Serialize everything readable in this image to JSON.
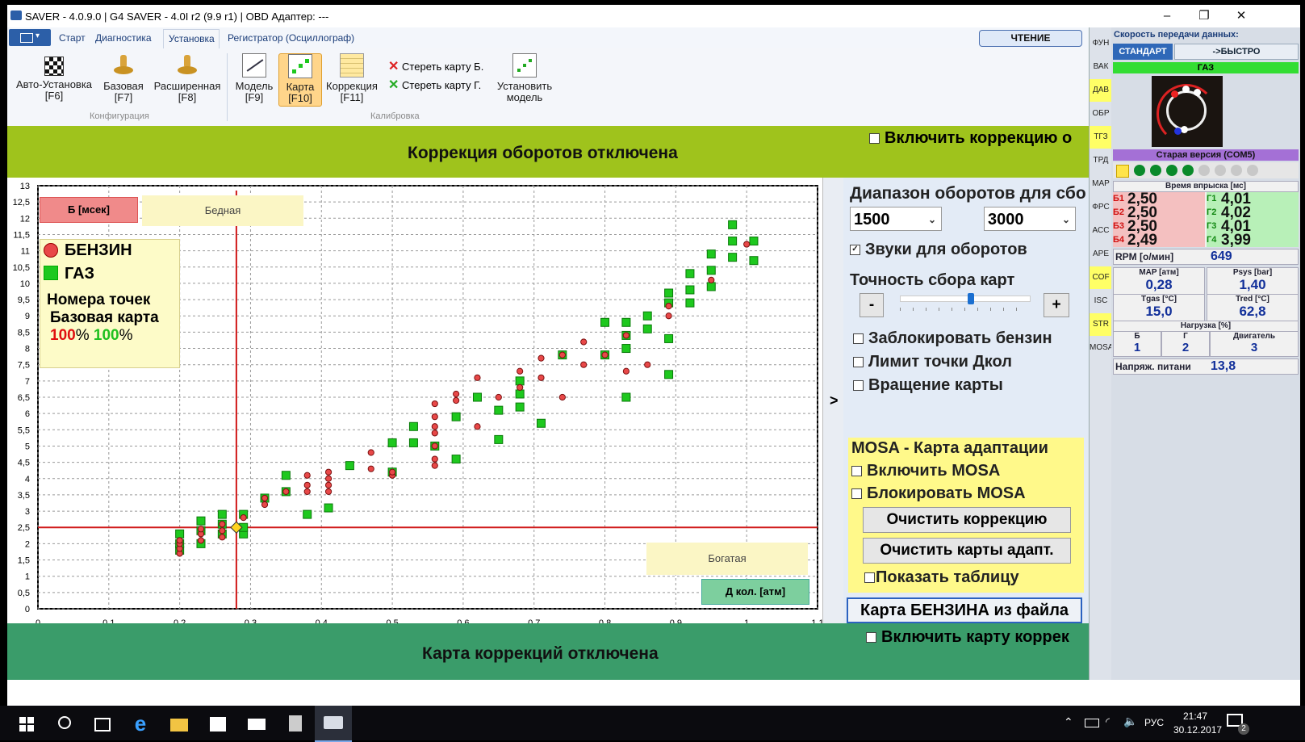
{
  "window": {
    "title": "SAVER - 4.0.9.0  |  G4 SAVER - 4.0I r2 (9.9 r1)  |  OBD Адаптер: ---",
    "controls": [
      "–",
      "❐",
      "✕"
    ]
  },
  "ribbon": {
    "tabs": [
      "Старт",
      "Диагностика",
      "Установка",
      "Регистратор (Осциллограф)"
    ],
    "active_tab": "Установка",
    "read_button": "ЧТЕНИЕ",
    "buttons": [
      {
        "label": "Авто-Установка",
        "key": "[F6]"
      },
      {
        "label": "Базовая",
        "key": "[F7]"
      },
      {
        "label": "Расширенная",
        "key": "[F8]"
      },
      {
        "label": "Модель",
        "key": "[F9]"
      },
      {
        "label": "Карта",
        "key": "[F10]"
      },
      {
        "label": "Коррекция",
        "key": "[F11]"
      }
    ],
    "erase_b": "Стереть карту Б.",
    "erase_g": "Стереть карту Г.",
    "install_model": "Установить модель",
    "group_config": "Конфигурация",
    "group_calib": "Калибровка"
  },
  "top_banner": {
    "text": "Коррекция оборотов отключена",
    "checkbox": "Включить коррекцию о"
  },
  "bottom_banner": {
    "text": "Карта коррекций отключена",
    "checkbox": "Включить карту коррек"
  },
  "chart_overlay": {
    "b_label": "Б [мсек]",
    "lean": "Бедная",
    "rich": "Богатая",
    "d_label": "Д кол. [атм]",
    "legend_petrol": "БЕНЗИН",
    "legend_gas": "ГАЗ",
    "points_title": "Номера точек",
    "base_map": "Базовая карта",
    "pct_red": "100",
    "pct_green": "100",
    "pct_sign": "%",
    "arrow": ">"
  },
  "chart_data": {
    "type": "scatter",
    "xlim": [
      0,
      1.1
    ],
    "ylim": [
      0,
      13
    ],
    "x_ticks": [
      "0",
      "0,1",
      "0,2",
      "0,3",
      "0,4",
      "0,5",
      "0,6",
      "0,7",
      "0,8",
      "0,9",
      "1",
      "1,1"
    ],
    "y_ticks": [
      "0",
      "0,5",
      "1",
      "1,5",
      "2",
      "2,5",
      "3",
      "3,5",
      "4",
      "4,5",
      "5",
      "5,5",
      "6",
      "6,5",
      "7",
      "7,5",
      "8",
      "8,5",
      "9",
      "9,5",
      "10",
      "10,5",
      "11",
      "11,5",
      "12",
      "12,5",
      "13"
    ],
    "grid": true,
    "cursor": {
      "x": 0.28,
      "y": 2.5
    },
    "series": [
      {
        "name": "БЕНЗИН",
        "color": "#e84848",
        "marker": "circle",
        "points": [
          [
            0.2,
            1.7
          ],
          [
            0.2,
            1.85
          ],
          [
            0.2,
            2.0
          ],
          [
            0.2,
            2.1
          ],
          [
            0.23,
            2.1
          ],
          [
            0.23,
            2.3
          ],
          [
            0.23,
            2.45
          ],
          [
            0.26,
            2.2
          ],
          [
            0.26,
            2.4
          ],
          [
            0.26,
            2.6
          ],
          [
            0.29,
            2.8
          ],
          [
            0.32,
            3.2
          ],
          [
            0.32,
            3.4
          ],
          [
            0.35,
            3.6
          ],
          [
            0.38,
            3.6
          ],
          [
            0.38,
            3.8
          ],
          [
            0.38,
            4.1
          ],
          [
            0.41,
            3.6
          ],
          [
            0.41,
            3.8
          ],
          [
            0.41,
            4.0
          ],
          [
            0.41,
            4.2
          ],
          [
            0.47,
            4.3
          ],
          [
            0.47,
            4.8
          ],
          [
            0.5,
            4.1
          ],
          [
            0.5,
            4.2
          ],
          [
            0.56,
            4.4
          ],
          [
            0.56,
            4.6
          ],
          [
            0.56,
            5.0
          ],
          [
            0.56,
            5.4
          ],
          [
            0.56,
            5.6
          ],
          [
            0.56,
            5.9
          ],
          [
            0.56,
            6.3
          ],
          [
            0.59,
            6.4
          ],
          [
            0.59,
            6.6
          ],
          [
            0.62,
            5.6
          ],
          [
            0.62,
            7.1
          ],
          [
            0.65,
            6.5
          ],
          [
            0.68,
            6.8
          ],
          [
            0.68,
            7.3
          ],
          [
            0.71,
            7.1
          ],
          [
            0.71,
            7.7
          ],
          [
            0.74,
            7.8
          ],
          [
            0.74,
            6.5
          ],
          [
            0.77,
            7.5
          ],
          [
            0.77,
            8.2
          ],
          [
            0.8,
            7.8
          ],
          [
            0.83,
            7.3
          ],
          [
            0.83,
            8.4
          ],
          [
            0.86,
            7.5
          ],
          [
            0.89,
            9.3
          ],
          [
            0.89,
            9.0
          ],
          [
            0.95,
            10.1
          ],
          [
            1.0,
            11.2
          ]
        ]
      },
      {
        "name": "ГАЗ",
        "color": "#1ec81e",
        "marker": "square",
        "points": [
          [
            0.2,
            1.8
          ],
          [
            0.2,
            2.0
          ],
          [
            0.2,
            2.3
          ],
          [
            0.23,
            2.0
          ],
          [
            0.23,
            2.4
          ],
          [
            0.23,
            2.7
          ],
          [
            0.26,
            2.3
          ],
          [
            0.26,
            2.6
          ],
          [
            0.26,
            2.9
          ],
          [
            0.29,
            2.3
          ],
          [
            0.29,
            2.5
          ],
          [
            0.29,
            2.9
          ],
          [
            0.32,
            3.4
          ],
          [
            0.35,
            3.6
          ],
          [
            0.35,
            4.1
          ],
          [
            0.38,
            2.9
          ],
          [
            0.41,
            3.1
          ],
          [
            0.44,
            4.4
          ],
          [
            0.5,
            4.2
          ],
          [
            0.5,
            5.1
          ],
          [
            0.53,
            5.1
          ],
          [
            0.53,
            5.6
          ],
          [
            0.56,
            5.0
          ],
          [
            0.59,
            4.6
          ],
          [
            0.59,
            5.9
          ],
          [
            0.62,
            6.5
          ],
          [
            0.65,
            5.2
          ],
          [
            0.65,
            6.1
          ],
          [
            0.68,
            6.2
          ],
          [
            0.68,
            6.6
          ],
          [
            0.68,
            7.0
          ],
          [
            0.71,
            5.7
          ],
          [
            0.74,
            7.8
          ],
          [
            0.8,
            7.8
          ],
          [
            0.8,
            8.8
          ],
          [
            0.83,
            6.5
          ],
          [
            0.83,
            8.0
          ],
          [
            0.83,
            8.4
          ],
          [
            0.83,
            8.8
          ],
          [
            0.86,
            8.6
          ],
          [
            0.86,
            9.0
          ],
          [
            0.89,
            7.2
          ],
          [
            0.89,
            8.3
          ],
          [
            0.89,
            9.4
          ],
          [
            0.89,
            9.7
          ],
          [
            0.92,
            9.4
          ],
          [
            0.92,
            9.8
          ],
          [
            0.92,
            10.3
          ],
          [
            0.95,
            9.9
          ],
          [
            0.95,
            10.4
          ],
          [
            0.95,
            10.9
          ],
          [
            0.98,
            10.8
          ],
          [
            0.98,
            11.3
          ],
          [
            0.98,
            11.8
          ],
          [
            1.01,
            10.7
          ],
          [
            1.01,
            11.3
          ]
        ]
      }
    ]
  },
  "settings": {
    "rpm_range_label": "Диапазон оборотов для сбо",
    "rpm_min": "1500",
    "rpm_max": "3000",
    "sounds": "Звуки для оборотов",
    "precision": "Точность сбора карт",
    "minus": "-",
    "plus": "+",
    "slider_level": 0.55,
    "lock_petrol": "Заблокировать бензин",
    "limit_point": "Лимит точки Дкол",
    "rotate_map": "Вращение карты",
    "mosa_title": "MOSA - Карта адаптации",
    "enable_mosa": "Включить MOSA",
    "block_mosa": "Блокировать MOSA",
    "clear_correction": "Очистить коррекцию",
    "clear_maps": "Очистить карты адапт.",
    "show_table": "Показать таблицу",
    "petrol_from_file": "Карта БЕНЗИНА из файла"
  },
  "side_strip": [
    {
      "label": "ФУН",
      "highlight": false
    },
    {
      "label": "ВАК",
      "highlight": false
    },
    {
      "label": "ДАВ",
      "highlight": true
    },
    {
      "label": "ОБР",
      "highlight": false
    },
    {
      "label": "ТГЗ",
      "highlight": true
    },
    {
      "label": "ТРД",
      "highlight": false
    },
    {
      "label": "МАР",
      "highlight": false
    },
    {
      "label": "ФРС",
      "highlight": false
    },
    {
      "label": "АСС",
      "highlight": false
    },
    {
      "label": "АРЕ",
      "highlight": false
    },
    {
      "label": "COF",
      "highlight": true
    },
    {
      "label": "ISC",
      "highlight": false
    },
    {
      "label": "STR",
      "highlight": true
    },
    {
      "label": "MOSA",
      "highlight": false
    }
  ],
  "status": {
    "speed_title": "Скорость передачи данных:",
    "std": "СТАНДАРТ",
    "fast": "->БЫСТРО",
    "gas": "ГАЗ",
    "old_version": "Старая версия (COM5)",
    "inj_title": "Время впрыска [мс]",
    "injectors": [
      {
        "b": "Б1",
        "bv": "2,50",
        "g": "Г1",
        "gv": "4,01"
      },
      {
        "b": "Б2",
        "bv": "2,50",
        "g": "Г2",
        "gv": "4,02"
      },
      {
        "b": "Б3",
        "bv": "2,50",
        "g": "Г3",
        "gv": "4,01"
      },
      {
        "b": "Б4",
        "bv": "2,49",
        "g": "Г4",
        "gv": "3,99"
      }
    ],
    "rpm_label": "RPM [о/мин]",
    "rpm_value": "649",
    "map_label": "MAP [атм]",
    "map_value": "0,28",
    "psys_label": "Psys [bar]",
    "psys_value": "1,40",
    "tgas_label": "Tgas [°C]",
    "tgas_value": "15,0",
    "tred_label": "Tred [°C]",
    "tred_value": "62,8",
    "load_label": "Нагрузка [%]",
    "load_b": "Б",
    "load_g": "Г",
    "load_e": "Двигатель",
    "load_b_val": "1",
    "load_g_val": "2",
    "load_e_val": "3",
    "voltage_label": "Напряж. питани",
    "voltage_value": "13,8"
  },
  "taskbar": {
    "lang": "РУС",
    "time": "21:47",
    "date": "30.12.2017",
    "notif_count": "2"
  }
}
